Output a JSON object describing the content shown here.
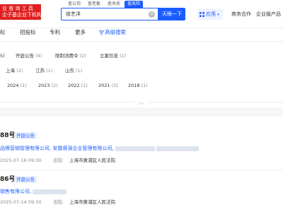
{
  "header": {
    "logo_line1": "业 查 询 工 具",
    "logo_line2": "企子基企业下机构",
    "site_tabs": [
      "查公司",
      "查老板",
      "查关系",
      "查风险"
    ],
    "search_value": "徐艺洋",
    "search_button": "天眼一下",
    "app_label": "应用",
    "links": [
      "商务合作",
      "企业版产品"
    ]
  },
  "nav": {
    "items": [
      "标",
      "招投标",
      "专利",
      "更多"
    ],
    "advanced": "高级搜索"
  },
  "filters": {
    "row1": [
      {
        "label": "5)",
        "count": ""
      },
      {
        "label": "开庭公告",
        "count": "(4)"
      },
      {
        "label": "限制消费令",
        "count": "(2)"
      },
      {
        "label": "立案信息",
        "count": "(1)"
      }
    ],
    "row2": [
      {
        "label": "上海",
        "count": "(2)"
      },
      {
        "label": "江苏",
        "count": "(1)"
      },
      {
        "label": "山东",
        "count": "(1)"
      }
    ],
    "row3": [
      {
        "label": "2024",
        "count": "(1)"
      },
      {
        "label": "2023",
        "count": "(2)"
      },
      {
        "label": "2022",
        "count": "(1)"
      },
      {
        "label": "2021",
        "count": "(3)"
      },
      {
        "label": "2018",
        "count": "(1)"
      }
    ]
  },
  "results": [
    {
      "title": "88号",
      "tag": "开庭公告",
      "party1": "品牌营销管理有限公司,",
      "party2": "安徽蓉源企业管理有限公司,",
      "date": "2025-07-16 09:30",
      "court_label": "法院:",
      "court": "上海市黄浦区人民法院"
    },
    {
      "title": "86号",
      "tag": "开庭公告",
      "party1": "销售有限公司,",
      "party2": "",
      "date": "2025-07-14 09:30",
      "court_label": "法院:",
      "court": "上海市黄浦区人民法院"
    }
  ],
  "colors": {
    "brand_red": "#e02020",
    "accent_blue": "#1a5cff"
  }
}
